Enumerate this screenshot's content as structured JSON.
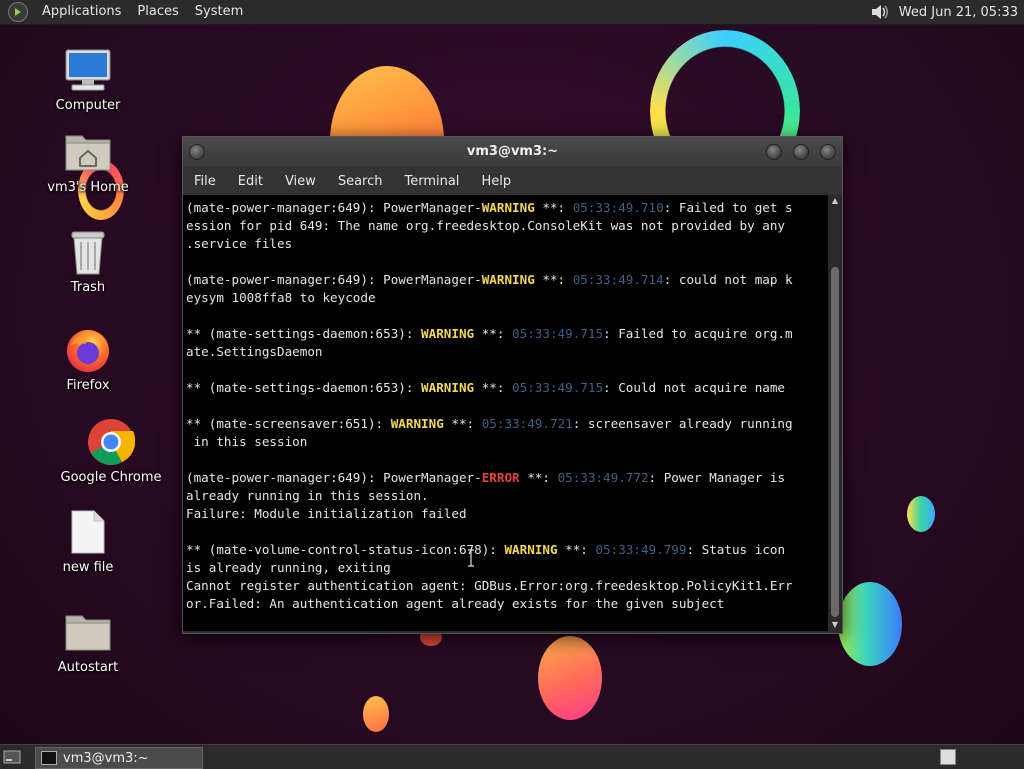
{
  "top_panel": {
    "menus": [
      "Applications",
      "Places",
      "System"
    ],
    "clock": "Wed Jun 21, 05:33"
  },
  "desktop_icons": [
    {
      "label": "Computer",
      "icon": "computer-icon"
    },
    {
      "label": "vm3's Home",
      "icon": "home-folder-icon"
    },
    {
      "label": "Trash",
      "icon": "trash-icon"
    },
    {
      "label": "Firefox",
      "icon": "firefox-icon"
    },
    {
      "label": "Google Chrome",
      "icon": "chrome-icon"
    },
    {
      "label": "new file",
      "icon": "file-icon"
    },
    {
      "label": "Autostart",
      "icon": "folder-icon"
    }
  ],
  "window": {
    "title": "vm3@vm3:~",
    "menu": [
      "File",
      "Edit",
      "View",
      "Search",
      "Terminal",
      "Help"
    ]
  },
  "terminal": {
    "lines": [
      [
        {
          "t": "(mate-power-manager:649): PowerManager-"
        },
        {
          "t": "WARNING",
          "c": "warn"
        },
        {
          "t": " **: "
        },
        {
          "t": "05:33:49.710",
          "c": "ts"
        },
        {
          "t": ": Failed to get s"
        }
      ],
      [
        {
          "t": "ession for pid 649: The name org.freedesktop.ConsoleKit was not provided by any"
        }
      ],
      [
        {
          "t": ".service files"
        }
      ],
      [
        {
          "t": ""
        }
      ],
      [
        {
          "t": "(mate-power-manager:649): PowerManager-"
        },
        {
          "t": "WARNING",
          "c": "warn"
        },
        {
          "t": " **: "
        },
        {
          "t": "05:33:49.714",
          "c": "ts"
        },
        {
          "t": ": could not map k"
        }
      ],
      [
        {
          "t": "eysym 1008ffa8 to keycode"
        }
      ],
      [
        {
          "t": ""
        }
      ],
      [
        {
          "t": "** (mate-settings-daemon:653): "
        },
        {
          "t": "WARNING",
          "c": "warn"
        },
        {
          "t": " **: "
        },
        {
          "t": "05:33:49.715",
          "c": "ts"
        },
        {
          "t": ": Failed to acquire org.m"
        }
      ],
      [
        {
          "t": "ate.SettingsDaemon"
        }
      ],
      [
        {
          "t": ""
        }
      ],
      [
        {
          "t": "** (mate-settings-daemon:653): "
        },
        {
          "t": "WARNING",
          "c": "warn"
        },
        {
          "t": " **: "
        },
        {
          "t": "05:33:49.715",
          "c": "ts"
        },
        {
          "t": ": Could not acquire name"
        }
      ],
      [
        {
          "t": ""
        }
      ],
      [
        {
          "t": "** (mate-screensaver:651): "
        },
        {
          "t": "WARNING",
          "c": "warn"
        },
        {
          "t": " **: "
        },
        {
          "t": "05:33:49.721",
          "c": "ts"
        },
        {
          "t": ": screensaver already running"
        }
      ],
      [
        {
          "t": " in this session"
        }
      ],
      [
        {
          "t": ""
        }
      ],
      [
        {
          "t": "(mate-power-manager:649): PowerManager-"
        },
        {
          "t": "ERROR",
          "c": "err"
        },
        {
          "t": " **: "
        },
        {
          "t": "05:33:49.772",
          "c": "ts"
        },
        {
          "t": ": Power Manager is"
        }
      ],
      [
        {
          "t": "already running in this session."
        }
      ],
      [
        {
          "t": "Failure: Module initialization failed"
        }
      ],
      [
        {
          "t": ""
        }
      ],
      [
        {
          "t": "** (mate-volume-control-status-icon:678): "
        },
        {
          "t": "WARNING",
          "c": "warn"
        },
        {
          "t": " **: "
        },
        {
          "t": "05:33:49.799",
          "c": "ts"
        },
        {
          "t": ": Status icon"
        }
      ],
      [
        {
          "t": "is already running, exiting"
        }
      ],
      [
        {
          "t": "Cannot register authentication agent: GDBus.Error:org.freedesktop.PolicyKit1.Err"
        }
      ],
      [
        {
          "t": "or.Failed: An authentication agent already exists for the given subject"
        }
      ]
    ]
  },
  "taskbar": {
    "task_label": "vm3@vm3:~"
  },
  "colors": {
    "warning": "#f2d94e",
    "error": "#e8413b",
    "timestamp": "#3f5f86"
  }
}
